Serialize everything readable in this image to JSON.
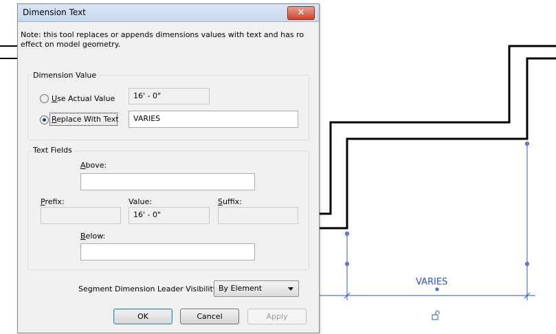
{
  "dialog": {
    "title": "Dimension Text",
    "close_glyph": "✕",
    "note": "Note: this tool replaces or appends dimensions values with text and has ro effect on model geometry.",
    "dimension_value": {
      "group_label": "Dimension Value",
      "use_actual_label_first": "U",
      "use_actual_label_rest": "se Actual Value",
      "actual_value": "16' - 0\"",
      "replace_label_first": "R",
      "replace_label_rest": "eplace With Text",
      "replace_text": "VARIES",
      "selected": "replace"
    },
    "text_fields": {
      "group_label": "Text Fields",
      "above_label_first": "A",
      "above_label_rest": "bove:",
      "above_value": "",
      "prefix_label_first": "P",
      "prefix_label_rest": "refix:",
      "prefix_value": "",
      "value_label": "Value:",
      "value": "16' - 0\"",
      "suffix_label_first": "S",
      "suffix_label_rest": "uffix:",
      "suffix_value": "",
      "below_label_first": "B",
      "below_label_rest": "elow:",
      "below_value": ""
    },
    "leader_visibility": {
      "label": "Segment Dimension Leader Visibility:",
      "selected": "By Element"
    },
    "buttons": {
      "ok": "OK",
      "cancel": "Cancel",
      "apply": "Apply"
    }
  },
  "canvas": {
    "dimension_text": "VARIES",
    "line_color": "#000000",
    "dimension_color": "#2c55b5",
    "lock_icon": "dimension-lock-icon"
  }
}
